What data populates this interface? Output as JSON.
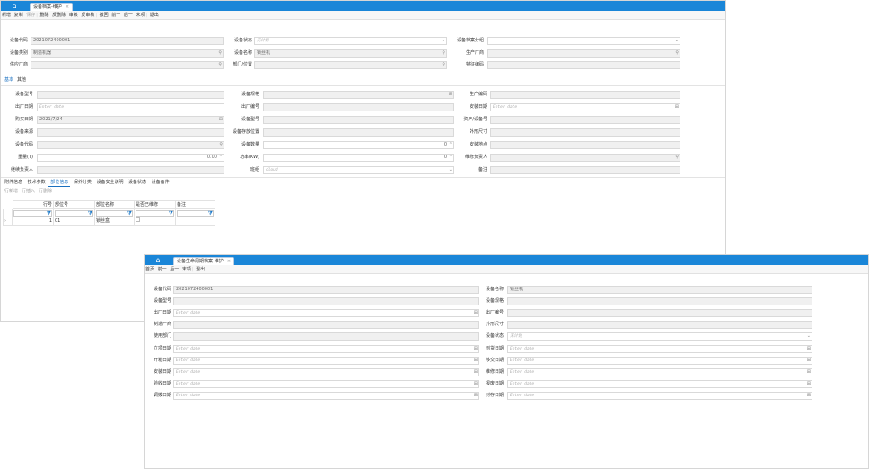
{
  "win1": {
    "tab_label": "设备档案-维护",
    "toolbar": [
      "新增",
      "复制",
      "保存",
      "删除",
      "反删除",
      "审核",
      "反审核",
      "撤回",
      "前一",
      "后一",
      "末项",
      "退出"
    ],
    "header_fields": [
      {
        "label": "设备代码",
        "value": "2021072400001"
      },
      {
        "label": "设备状态",
        "value": "无计划"
      },
      {
        "label": "设备档案分组",
        "value": ""
      },
      {
        "label": "设备类别",
        "value": "制造机器"
      },
      {
        "label": "设备名称",
        "value": "锁丝机"
      },
      {
        "label": "生产厂商",
        "value": ""
      },
      {
        "label": "供应厂商",
        "value": ""
      },
      {
        "label": "部门/位置",
        "value": ""
      },
      {
        "label": "特征编码",
        "value": ""
      }
    ],
    "section_tabs": [
      "基本",
      "其他"
    ],
    "basic_fields": [
      {
        "label": "设备型号",
        "value": ""
      },
      {
        "label": "设备规格",
        "value": ""
      },
      {
        "label": "生产编码",
        "value": ""
      },
      {
        "label": "出厂日期",
        "value": "Enter date"
      },
      {
        "label": "出厂编号",
        "value": ""
      },
      {
        "label": "安装日期",
        "value": "Enter date"
      },
      {
        "label": "购买日期",
        "value": "2021/7/24"
      },
      {
        "label": "设备型号",
        "value": ""
      },
      {
        "label": "资产/设备号",
        "value": ""
      },
      {
        "label": "设备来源",
        "value": ""
      },
      {
        "label": "设备存放位置",
        "value": ""
      },
      {
        "label": "外形尺寸",
        "value": ""
      },
      {
        "label": "设备代码",
        "value": ""
      },
      {
        "label": "设备数量",
        "value": "0"
      },
      {
        "label": "安装地点",
        "value": ""
      },
      {
        "label": "重量(T)",
        "value": "0.00"
      },
      {
        "label": "功率(KW)",
        "value": "0"
      },
      {
        "label": "维修负责人",
        "value": ""
      },
      {
        "label": "继续负责人",
        "value": ""
      },
      {
        "label": "班组",
        "value": "cloud"
      },
      {
        "label": "备注",
        "value": ""
      }
    ],
    "bottom_tabs": [
      "附件信息",
      "技术参数",
      "部位信息",
      "保养分类",
      "设备安全说明",
      "设备状态",
      "设备备件"
    ],
    "grid_toolbar": [
      "行新增",
      "行插入",
      "行删除"
    ],
    "grid_headers": [
      "行号",
      "部位号",
      "部位名称",
      "是否已维修",
      "备注"
    ],
    "grid_rows": [
      {
        "rownum": "1",
        "code": "01",
        "name": "锁丝盒"
      }
    ]
  },
  "win2": {
    "tab_label": "设备生命周期档案-维护",
    "toolbar": [
      "首页",
      "前一",
      "后一",
      "末项",
      "退出"
    ],
    "fields_left": [
      {
        "label": "设备代码",
        "value": "2021072400001"
      },
      {
        "label": "设备型号",
        "value": ""
      },
      {
        "label": "出厂日期",
        "value": "Enter date"
      },
      {
        "label": "制造厂商",
        "value": ""
      },
      {
        "label": "使用部门",
        "value": ""
      },
      {
        "label": "立项日期",
        "value": "Enter date"
      },
      {
        "label": "开箱日期",
        "value": "Enter date"
      },
      {
        "label": "安装日期",
        "value": "Enter date"
      },
      {
        "label": "验收日期",
        "value": "Enter date"
      },
      {
        "label": "调拨日期",
        "value": "Enter date"
      }
    ],
    "fields_right": [
      {
        "label": "设备名称",
        "value": "锁丝机"
      },
      {
        "label": "设备规格",
        "value": ""
      },
      {
        "label": "出厂编号",
        "value": ""
      },
      {
        "label": "外形尺寸",
        "value": ""
      },
      {
        "label": "设备状态",
        "value": "无计划"
      },
      {
        "label": "到货日期",
        "value": "Enter date"
      },
      {
        "label": "移交日期",
        "value": "Enter date"
      },
      {
        "label": "维修日期",
        "value": "Enter date"
      },
      {
        "label": "报废日期",
        "value": "Enter date"
      },
      {
        "label": "封存日期",
        "value": "Enter date"
      }
    ]
  }
}
